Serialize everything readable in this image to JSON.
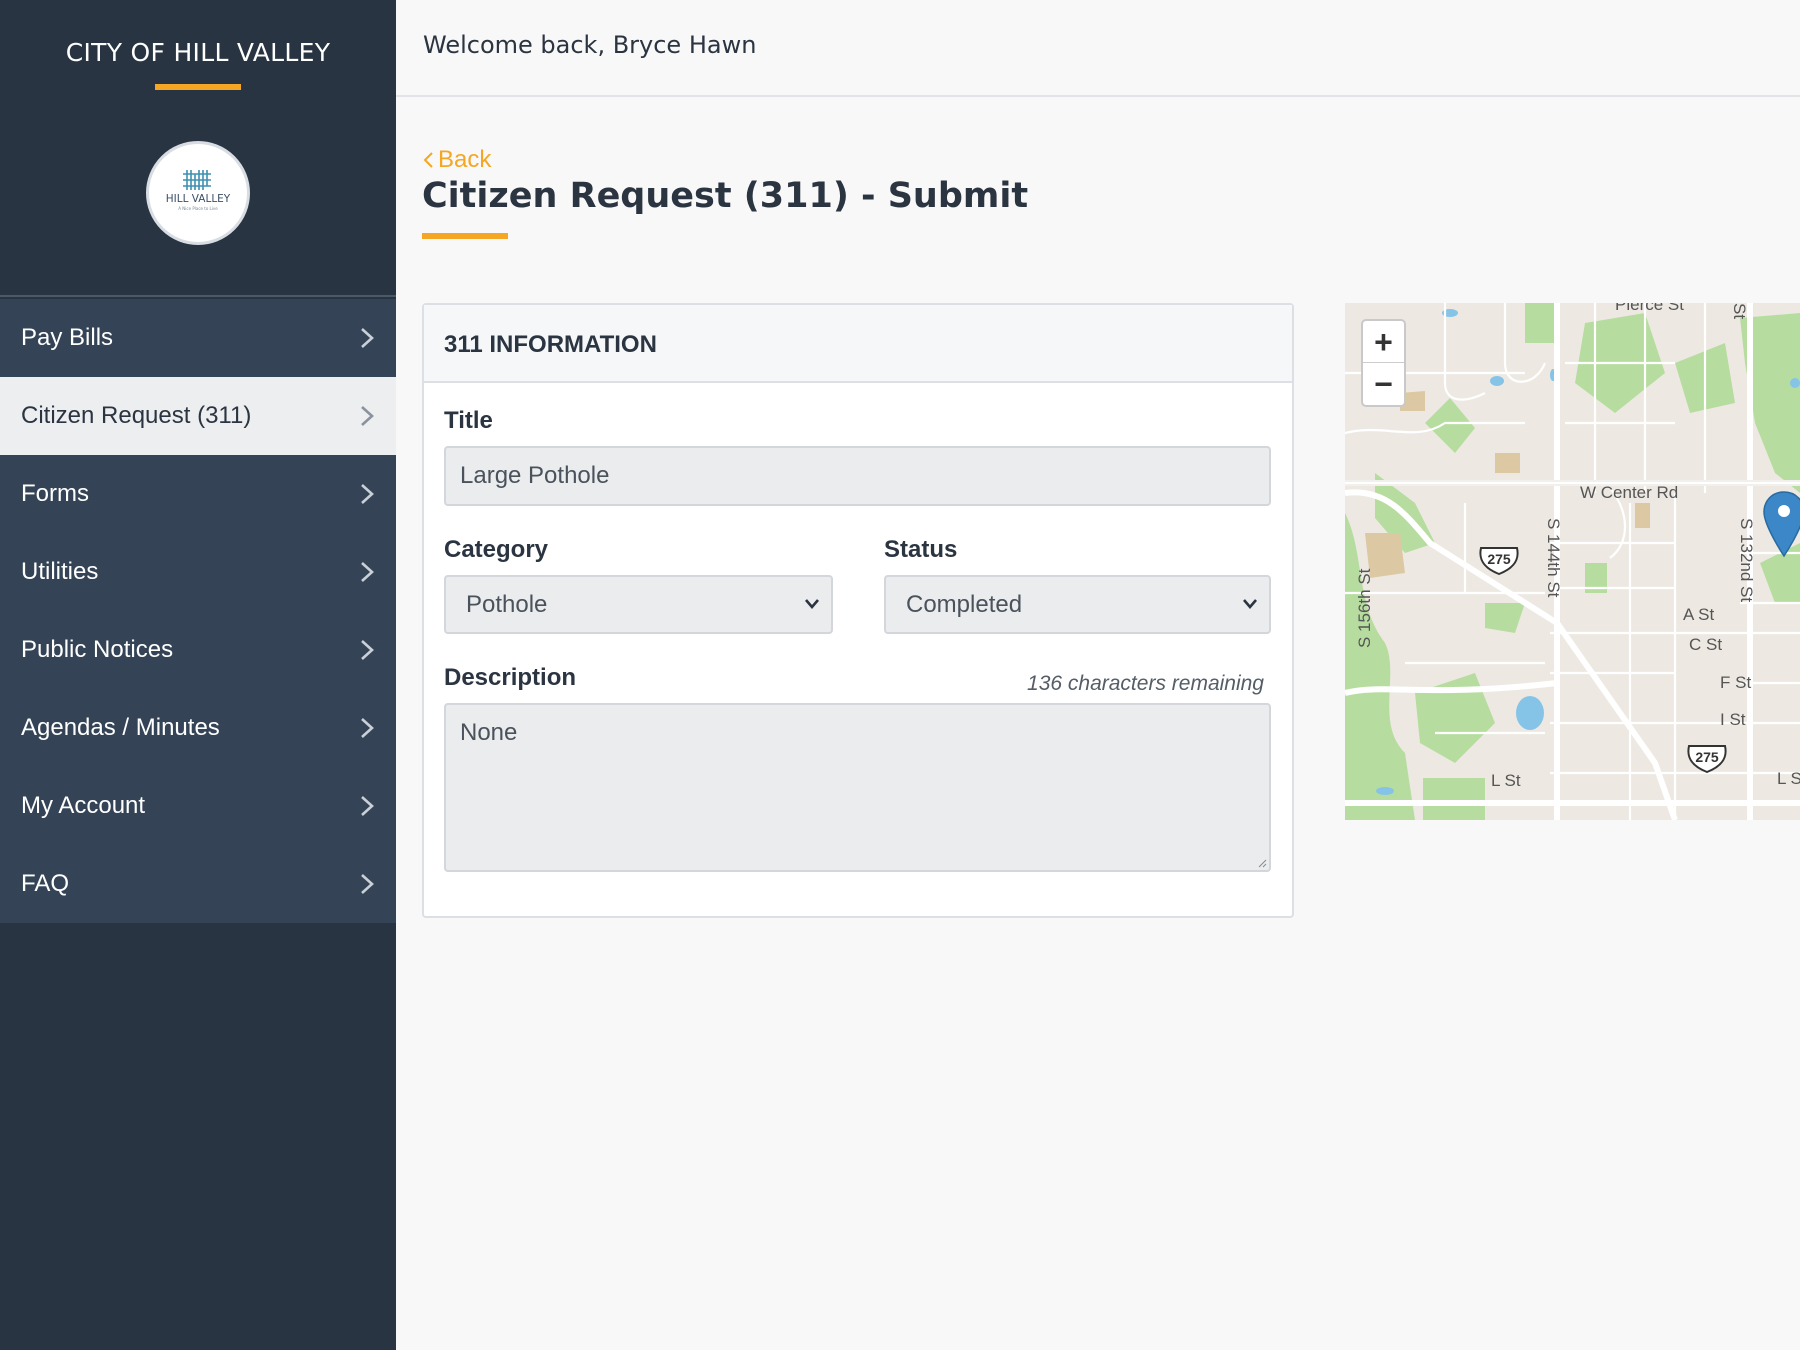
{
  "sidebar": {
    "brand_title": "CITY OF HILL VALLEY",
    "logo_text": "HILL VALLEY",
    "logo_tagline": "A Nice Place to Live",
    "items": [
      {
        "label": "Pay Bills",
        "icon": "chevron-right-icon"
      },
      {
        "label": "Citizen Request (311)",
        "icon": "chevron-right-icon",
        "active": true
      },
      {
        "label": "Forms",
        "icon": "chevron-right-icon"
      },
      {
        "label": "Utilities",
        "icon": "chevron-right-icon"
      },
      {
        "label": "Public Notices",
        "icon": "chevron-right-icon"
      },
      {
        "label": "Agendas / Minutes",
        "icon": "chevron-right-icon"
      },
      {
        "label": "My Account",
        "icon": "chevron-right-icon"
      },
      {
        "label": "FAQ",
        "icon": "chevron-right-icon"
      }
    ]
  },
  "header": {
    "welcome": "Welcome back, Bryce Hawn"
  },
  "page": {
    "back_label": "Back",
    "title": "Citizen Request (311) - Submit"
  },
  "form": {
    "section_title": "311 INFORMATION",
    "title_label": "Title",
    "title_value": "Large Pothole",
    "category_label": "Category",
    "category_value": "Pothole",
    "status_label": "Status",
    "status_value": "Completed",
    "description_label": "Description",
    "chars_remaining": "136 characters remaining",
    "description_value": "None"
  },
  "map": {
    "zoom_in": "+",
    "zoom_out": "−",
    "labels": {
      "pierce": "Pierce St",
      "w_center": "W Center Rd",
      "s156": "S 156th St",
      "s144": "S 144th St",
      "s132": "S 132nd St",
      "a_st": "A St",
      "c_st": "C St",
      "f_st": "F St",
      "i_st": "I St",
      "l_st": "L St",
      "l_st_2": "L S",
      "st_partial": "St",
      "route_1": "275",
      "route_2": "275"
    }
  },
  "colors": {
    "sidebar_bg": "#283442",
    "nav_bg": "#344456",
    "nav_active_bg": "#edeef0",
    "accent": "#f5a623",
    "pin": "#3b87c7"
  }
}
